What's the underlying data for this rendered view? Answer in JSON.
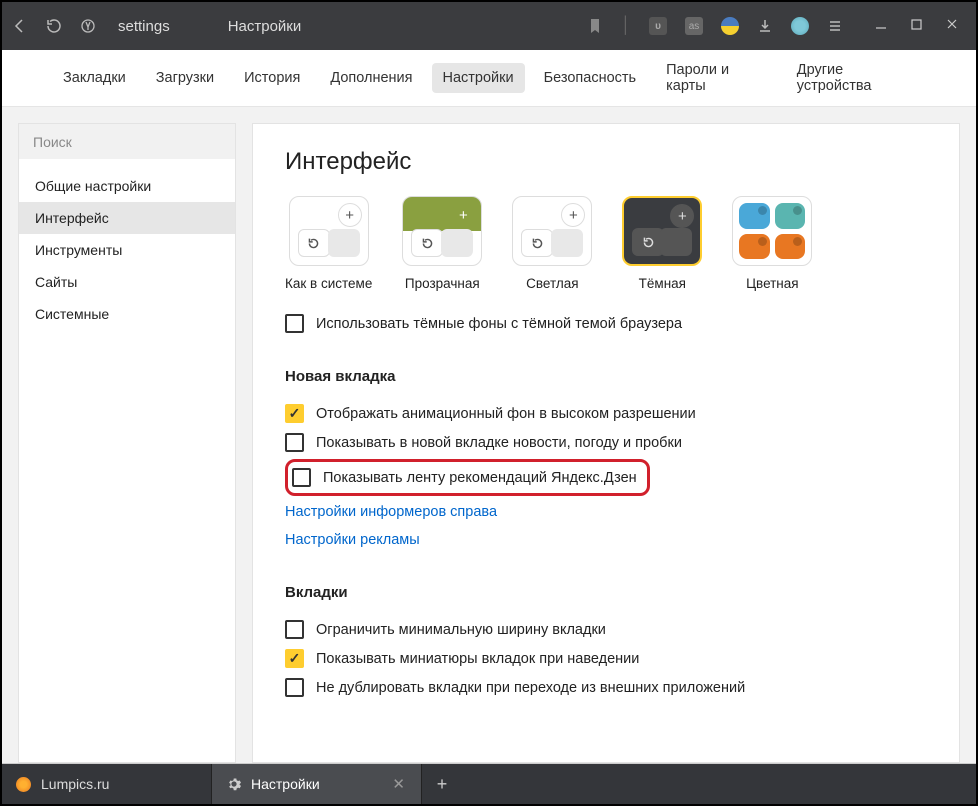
{
  "toolbar": {
    "url_label": "settings",
    "page_title": "Настройки"
  },
  "topnav": {
    "items": [
      "Закладки",
      "Загрузки",
      "История",
      "Дополнения",
      "Настройки",
      "Безопасность",
      "Пароли и карты",
      "Другие устройства"
    ],
    "active_index": 4
  },
  "sidebar": {
    "search_placeholder": "Поиск",
    "items": [
      "Общие настройки",
      "Интерфейс",
      "Инструменты",
      "Сайты",
      "Системные"
    ],
    "active_index": 1
  },
  "content": {
    "heading": "Интерфейс",
    "themes": [
      {
        "label": "Как в системе"
      },
      {
        "label": "Прозрачная"
      },
      {
        "label": "Светлая"
      },
      {
        "label": "Тёмная",
        "selected": true
      },
      {
        "label": "Цветная"
      }
    ],
    "dark_bg_option": "Использовать тёмные фоны с тёмной темой браузера",
    "new_tab": {
      "title": "Новая вкладка",
      "items": [
        {
          "label": "Отображать анимационный фон в высоком разрешении",
          "checked": true
        },
        {
          "label": "Показывать в новой вкладке новости, погоду и пробки",
          "checked": false
        },
        {
          "label": "Показывать ленту рекомендаций Яндекс.Дзен",
          "checked": false,
          "highlighted": true
        }
      ],
      "links": [
        "Настройки информеров справа",
        "Настройки рекламы"
      ]
    },
    "tabs_section": {
      "title": "Вкладки",
      "items": [
        {
          "label": "Ограничить минимальную ширину вкладки",
          "checked": false
        },
        {
          "label": "Показывать миниатюры вкладок при наведении",
          "checked": true
        },
        {
          "label": "Не дублировать вкладки при переходе из внешних приложений",
          "checked": false
        }
      ]
    }
  },
  "tabbar": {
    "tabs": [
      {
        "title": "Lumpics.ru"
      },
      {
        "title": "Настройки",
        "active": true
      }
    ]
  }
}
